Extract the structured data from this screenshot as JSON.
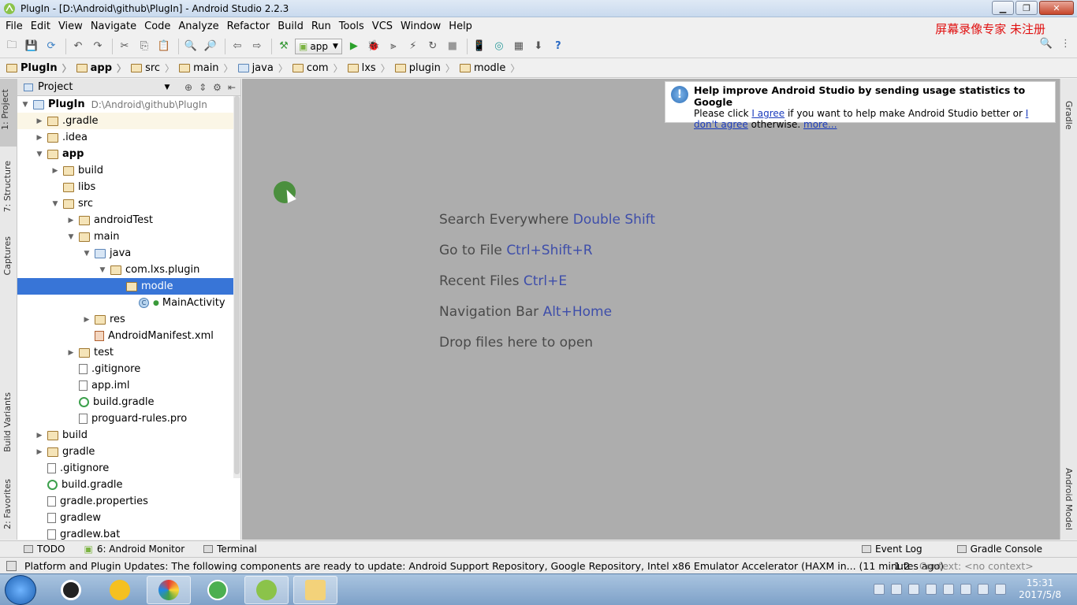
{
  "window": {
    "title": "PlugIn - [D:\\Android\\github\\PlugIn] - Android Studio 2.2.3",
    "minimize": "▁",
    "maximize": "❐",
    "close": "✕"
  },
  "watermark": "屏幕录像专家  未注册",
  "menu": [
    "File",
    "Edit",
    "View",
    "Navigate",
    "Code",
    "Analyze",
    "Refactor",
    "Build",
    "Run",
    "Tools",
    "VCS",
    "Window",
    "Help"
  ],
  "toolbar": {
    "run_config": "app",
    "help": "?"
  },
  "breadcrumb": [
    "PlugIn",
    "app",
    "src",
    "main",
    "java",
    "com",
    "lxs",
    "plugin",
    "modle"
  ],
  "left_tabs": [
    "1: Project",
    "7: Structure",
    "Captures",
    "Build Variants",
    "2: Favorites"
  ],
  "right_tabs": [
    "Gradle",
    "Android Model"
  ],
  "project_panel": {
    "title": "Project",
    "tree": [
      {
        "label": "PlugIn",
        "path": "D:\\Android\\github\\PlugIn",
        "twist": "▼"
      },
      {
        "label": ".gradle",
        "twist": "▶"
      },
      {
        "label": ".idea",
        "twist": "▶"
      },
      {
        "label": "app",
        "twist": "▼"
      },
      {
        "label": "build",
        "twist": "▶"
      },
      {
        "label": "libs",
        "twist": ""
      },
      {
        "label": "src",
        "twist": "▼"
      },
      {
        "label": "androidTest",
        "twist": "▶"
      },
      {
        "label": "main",
        "twist": "▼"
      },
      {
        "label": "java",
        "twist": "▼"
      },
      {
        "label": "com.lxs.plugin",
        "twist": "▼"
      },
      {
        "label": "modle",
        "twist": ""
      },
      {
        "label": "MainActivity",
        "twist": ""
      },
      {
        "label": "res",
        "twist": "▶"
      },
      {
        "label": "AndroidManifest.xml",
        "twist": ""
      },
      {
        "label": "test",
        "twist": "▶"
      },
      {
        "label": ".gitignore",
        "twist": ""
      },
      {
        "label": "app.iml",
        "twist": ""
      },
      {
        "label": "build.gradle",
        "twist": ""
      },
      {
        "label": "proguard-rules.pro",
        "twist": ""
      },
      {
        "label": "build",
        "twist": "▶"
      },
      {
        "label": "gradle",
        "twist": "▶"
      },
      {
        "label": ".gitignore",
        "twist": ""
      },
      {
        "label": "build.gradle",
        "twist": ""
      },
      {
        "label": "gradle.properties",
        "twist": ""
      },
      {
        "label": "gradlew",
        "twist": ""
      },
      {
        "label": "gradlew.bat",
        "twist": ""
      }
    ]
  },
  "editor": {
    "hints": [
      {
        "text": "Search Everywhere",
        "key": "Double Shift"
      },
      {
        "text": "Go to File",
        "key": "Ctrl+Shift+R"
      },
      {
        "text": "Recent Files",
        "key": "Ctrl+E"
      },
      {
        "text": "Navigation Bar",
        "key": "Alt+Home"
      },
      {
        "text": "Drop files here to open",
        "key": ""
      }
    ]
  },
  "notification": {
    "title": "Help improve Android Studio by sending usage statistics to Google",
    "line1": "Please click ",
    "agree": "I agree",
    "line2": " if you want to help make Android Studio better or ",
    "disagree": "I don't agree",
    "line3": " otherwise. ",
    "more": "more..."
  },
  "bottom_tools": {
    "todo": "TODO",
    "monitor": "6: Android Monitor",
    "terminal": "Terminal",
    "event_log": "Event Log",
    "gradle_console": "Gradle Console"
  },
  "status": {
    "message": "Platform and Plugin Updates: The following components are ready to update: Android Support Repository, Google Repository, Intel x86 Emulator Accelerator (HAXM in... (11 minutes ago)",
    "position": "1:2",
    "context": "Context: <no context>"
  },
  "taskbar": {
    "time": "15:31",
    "date": "2017/5/8"
  }
}
